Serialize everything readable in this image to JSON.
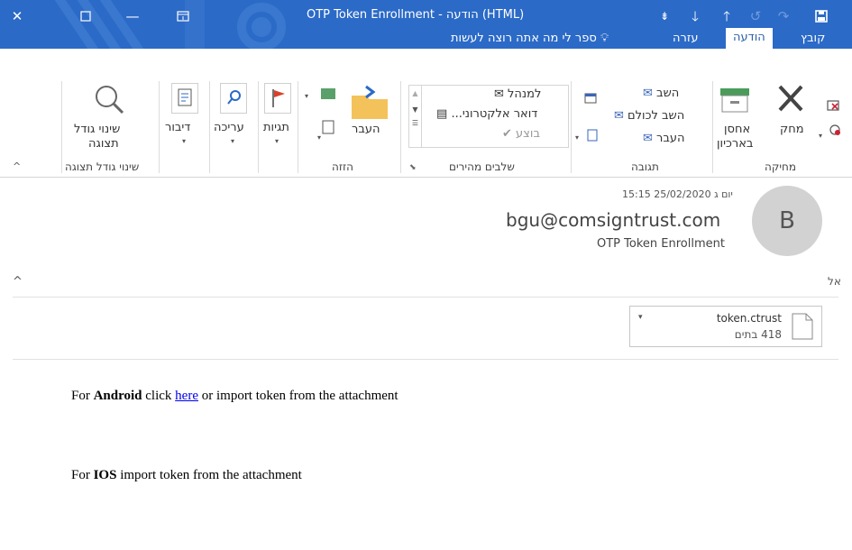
{
  "window": {
    "title": "OTP Token Enrollment  -  הודעה (HTML)",
    "accent": "#2b6ac7"
  },
  "tabs": [
    {
      "label": "קובץ"
    },
    {
      "label": "הודעה",
      "active": true
    },
    {
      "label": "עזרה"
    }
  ],
  "tell_me": "ספר לי מה אתה רוצה לעשות",
  "ribbon": {
    "delete_group": {
      "label": "מחיקה",
      "delete": "מחק",
      "archive": "אחסן",
      "archive2": "בארכיון"
    },
    "respond_group": {
      "label": "תגובה",
      "reply": "השב",
      "reply_all": "השב לכולם",
      "forward": "העבר"
    },
    "quicksteps_group": {
      "label": "שלבים מהירים",
      "to_manager": "למנהל",
      "email": "דואר אלקטרוני...",
      "done": "בוצע"
    },
    "move_group": {
      "label": "הזזה",
      "move": "העבר"
    },
    "tags": "תגיות",
    "editing": "עריכה",
    "speech": "דיבור",
    "zoom_group": {
      "label": "שינוי גודל תצוגה",
      "zoom1": "שינוי גודל",
      "zoom2": "תצוגה"
    }
  },
  "message": {
    "date": "יום ג 25/02/2020 15:15",
    "sender": "bgu@comsigntrust.com",
    "subject": "OTP Token Enrollment",
    "avatar_letter": "B",
    "to_label": "אל"
  },
  "attachment": {
    "name": "token.ctrust",
    "size": "418 בתים"
  },
  "body": {
    "line1_prefix": "For ",
    "line1_bold": "Android",
    "line1_mid": " click ",
    "line1_link": "here",
    "line1_suffix": " or import token from the attachment",
    "line2_prefix": "For ",
    "line2_bold": "IOS",
    "line2_suffix": " import token from the attachment"
  }
}
